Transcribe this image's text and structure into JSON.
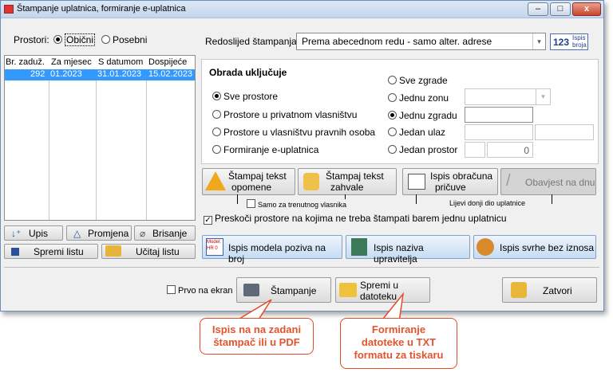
{
  "window": {
    "title": "Štampanje uplatnica, formiranje e-uplatnica",
    "close_glyph": "x",
    "min_glyph": "–",
    "max_glyph": "□"
  },
  "prostori": {
    "label": "Prostori:",
    "opt1": "Obični",
    "opt2": "Posebni"
  },
  "table": {
    "headers": [
      "Br. zaduž.",
      "Za mjesec",
      "S datumom",
      "Dospijeće"
    ],
    "rows": [
      [
        "292",
        "01.2023",
        "31.01.2023",
        "15.02.2023"
      ]
    ]
  },
  "left_buttons": {
    "upis": "Upis",
    "promjena": "Promjena",
    "brisanje": "Brisanje",
    "spremi": "Spremi listu",
    "ucitaj": "Učitaj listu"
  },
  "redoslijed": {
    "label": "Redoslijed štampanja:",
    "value": "Prema abecednom redu - samo alter. adrese",
    "ispis_num": "123",
    "ispis_l1": "Ispis",
    "ispis_l2": "broja"
  },
  "obrada": {
    "title": "Obrada uključuje",
    "left": [
      "Sve prostore",
      "Prostore u privatnom vlasništvu",
      "Prostore u vlasništvu pravnih osoba",
      "Formiranje e-uplatnica"
    ],
    "right": [
      "Sve zgrade",
      "Jednu zonu",
      "Jednu zgradu",
      "Jedan ulaz",
      "Jedan prostor"
    ],
    "prostor_value": "0"
  },
  "print_buttons": {
    "opomene_l1": "Štampaj tekst",
    "opomene_l2": "opomene",
    "zahvale_l1": "Štampaj tekst",
    "zahvale_l2": "zahvale",
    "obracuna_l1": "Ispis obračuna",
    "obracuna_l2": "pričuve",
    "obavijest": "Obavjest na dnu",
    "samo_vlasnika": "Samo za trenutnog vlasnika",
    "lijevi_donji": "Lijevi donji dio uplatnice"
  },
  "preskoci": "Preskoči prostore na kojima ne treba štampati barem jednu uplatnicu",
  "big_buttons": {
    "model": "Ispis modela poziva na broj",
    "model_icon_l1": "Model:",
    "model_icon_l2": "HR 0",
    "upravitelja": "Ispis naziva upravitelja",
    "svrhe": "Ispis svrhe bez iznosa"
  },
  "bottom": {
    "prvo": "Prvo na ekran",
    "stampanje": "Štampanje",
    "spremi_l1": "Spremi u",
    "spremi_l2": "datoteku",
    "zatvori": "Zatvori"
  },
  "callouts": {
    "c1_l1": "Ispis na na zadani",
    "c1_l2": "štampač  ili u PDF",
    "c2_l1": "Formiranje",
    "c2_l2": "datoteke u TXT",
    "c2_l3": "formatu za tiskaru"
  }
}
